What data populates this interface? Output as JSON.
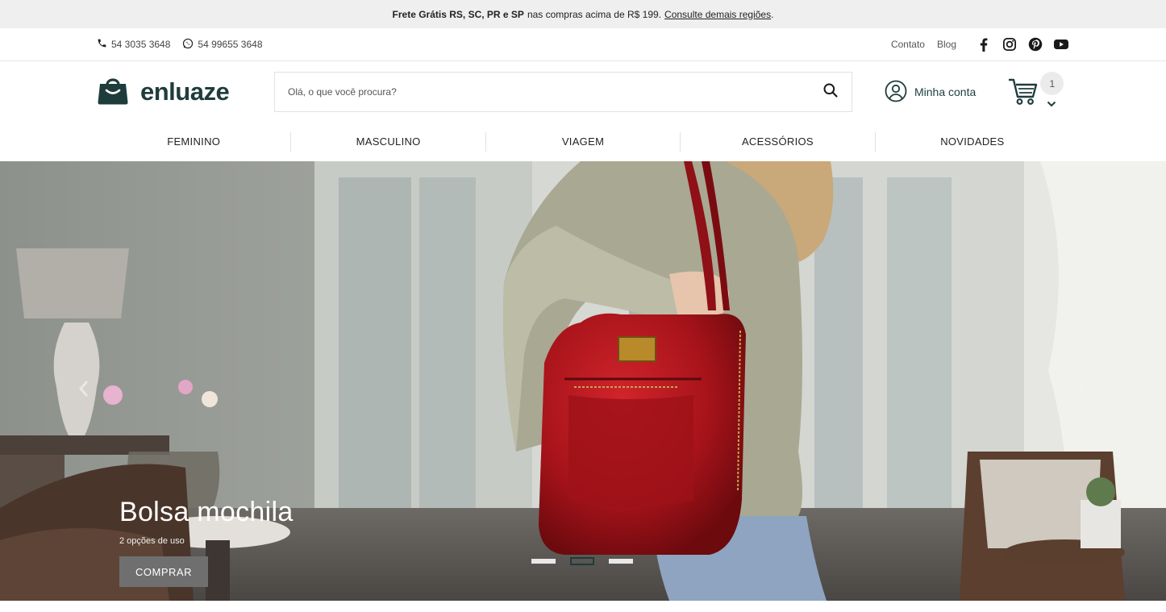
{
  "promo": {
    "bold": "Frete Grátis RS, SC, PR e SP",
    "text": "nas compras acima de R$ 199.",
    "link": "Consulte demais regiões",
    "end": "."
  },
  "contact": {
    "phone": "54 3035 3648",
    "whatsapp": "54 99655 3648",
    "links": [
      "Contato",
      "Blog"
    ],
    "social_icons": [
      "facebook-icon",
      "instagram-icon",
      "pinterest-icon",
      "youtube-icon"
    ]
  },
  "header": {
    "logo": "enluaze",
    "search_placeholder": "Olá, o que você procura?",
    "account_label": "Minha conta",
    "cart_count": "1"
  },
  "nav": [
    "FEMININO",
    "MASCULINO",
    "VIAGEM",
    "ACESSÓRIOS",
    "NOVIDADES"
  ],
  "hero": {
    "title": "Bolsa mochila",
    "subtitle": "2 opções de uso",
    "button": "COMPRAR",
    "active_slide": 2,
    "slide_count": 3
  },
  "colors": {
    "brand": "#1f3c3c",
    "bag_red": "#b3141b"
  }
}
